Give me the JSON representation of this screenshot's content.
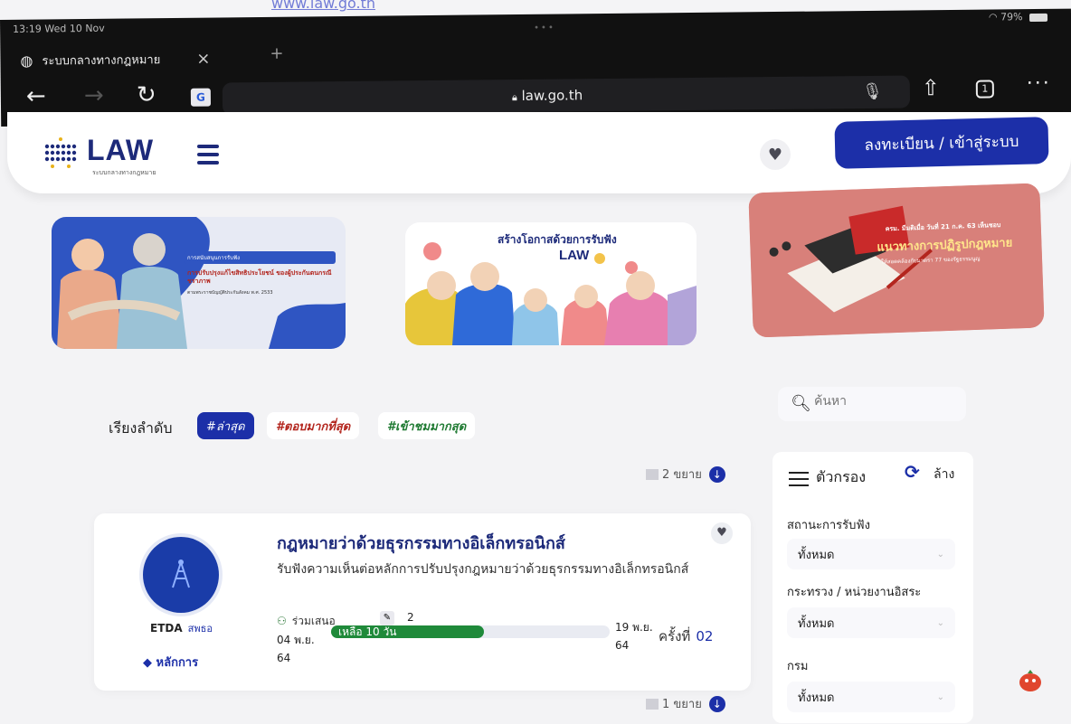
{
  "paper": {
    "link_text": "www.law.go.th"
  },
  "status_bar": {
    "time": "13:19",
    "date": "Wed 10 Nov",
    "battery": "79%"
  },
  "browser": {
    "tab_title": "ระบบกลางทางกฎหมาย",
    "tab_close": "×",
    "new_tab": "+",
    "url": "law.go.th",
    "translate_label": "G",
    "tab_count": "1",
    "icons": [
      "back-arrow-icon",
      "forward-arrow-icon",
      "reload-icon",
      "translate-icon",
      "lock-icon",
      "mic-icon",
      "share-icon",
      "tabs-icon",
      "more-icon"
    ]
  },
  "site": {
    "logo_text": "LAW",
    "logo_subtitle": "ระบบกลางทางกฎหมาย",
    "login_label": "ลงทะเบียน / เข้าสู่ระบบ"
  },
  "banners": [
    {
      "header": "การสนับสนุนการรับฟัง",
      "text": "การปรับปรุงแก้ไขสิทธิประโยชน์ ของผู้ประกันตนกรณีชราภาพ",
      "footnote": "ตามพระราชบัญญัติประกันสังคม พ.ศ. 2533"
    },
    {
      "text": "สร้างโอกาสด้วยการรับฟัง",
      "logo": "LAW"
    },
    {
      "line1": "ครม. มีมติเมื่อ วันที่ 21 ก.ค. 63 เห็นชอบ",
      "line2": "แนวทางการปฏิรูปกฎหมาย",
      "line3": "ให้สอดคล้องกับมาตรา 77 ของรัฐธรรมนูญ"
    }
  ],
  "sort": {
    "label": "เรียงลำดับ",
    "tags": [
      "#ล่าสุด",
      "#ตอบมากที่สุด",
      "#เข้าชมมากสุด"
    ],
    "active_index": 0
  },
  "search": {
    "placeholder": "ค้นหา"
  },
  "expand_top": {
    "count_label": "2 ขยาย"
  },
  "expand_bottom": {
    "count_label": "1 ขยาย"
  },
  "card": {
    "title": "กฎหมายว่าด้วยธุรกรรมทางอิเล็กทรอนิกส์",
    "description": "รับฟังความเห็นต่อหลักการปรับปรุงกฎหมายว่าด้วยธุรกรรมทางอิเล็กทรอนิกส์",
    "org_name": "ETDA",
    "org_sub": "สพธอ",
    "category": "หลักการ",
    "participants_label": "ร่วมเสนอ",
    "participants_count": "2",
    "start_date": "04 พ.ย.",
    "start_year": "64",
    "end_date": "19 พ.ย.",
    "end_year": "64",
    "remaining_label": "เหลือ 10 วัน",
    "progress": 0.55,
    "round_label": "ครั้งที่",
    "round_value": "02"
  },
  "filter": {
    "title": "ตัวกรอง",
    "reset_label": "ล้าง",
    "fields": [
      {
        "label": "สถานะการรับฟัง",
        "value": "ทั้งหมด"
      },
      {
        "label": "กระทรวง / หน่วยงานอิสระ",
        "value": "ทั้งหมด"
      },
      {
        "label": "กรม",
        "value": "ทั้งหมด"
      }
    ]
  },
  "colors": {
    "primary": "#1c2fa8",
    "navy": "#1d2a7a",
    "green": "#1f8a3a",
    "red": "#b3261e"
  }
}
